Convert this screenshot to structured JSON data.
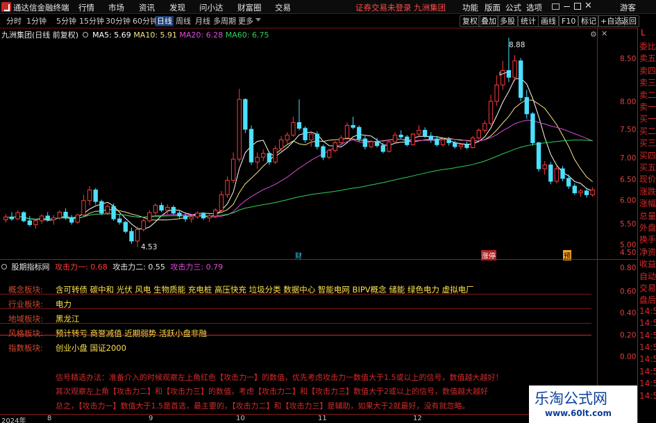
{
  "app_title": "通达信金融终端",
  "menu": [
    "行情",
    "市场",
    "资讯",
    "发现",
    "问小达",
    "财富圈",
    "交易"
  ],
  "warning": "证券交易未登录 九洲集团",
  "sys_menu": [
    "功能",
    "版面",
    "公式",
    "选项"
  ],
  "user": "游客",
  "periods": [
    "分时",
    "1分钟",
    "5分钟",
    "15分钟",
    "30分钟",
    "60分钟",
    "日线",
    "周线",
    "月线",
    "多周期",
    "更多"
  ],
  "active_period": "日线",
  "tools": [
    "复权",
    "叠加",
    "多股",
    "统计",
    "画线",
    "F10",
    "标记",
    "+自选",
    "返回"
  ],
  "chart_header": {
    "title": "九洲集团(日线 前复权)",
    "ma5": "MA5: 5.69",
    "ma10": "MA10: 5.91",
    "ma20": "MA20: 6.28",
    "ma60": "MA60: 6.75"
  },
  "colors": {
    "up": "#ff3b3b",
    "down": "#4ce0ff",
    "ma5": "#ffffff",
    "ma10": "#f4e38a",
    "ma20": "#e04bdc",
    "ma60": "#2fd05a",
    "red_text": "#e33b3b",
    "yellow": "#ffe24a"
  },
  "price_axis": [
    "8.50",
    "8.00",
    "7.50",
    "7.00",
    "6.50",
    "6.00",
    "5.50",
    "5.00",
    "4.50"
  ],
  "rail_items": [
    "委比",
    "卖五",
    "卖四",
    "卖三",
    "卖二",
    "卖一",
    "买一",
    "买二",
    "买三",
    "买四",
    "买五",
    "现价",
    "涨跌",
    "涨幅",
    "总量",
    "外盘",
    "换手",
    "净资",
    "收益",
    "自动",
    "交易",
    "盘后",
    "14:5",
    "14:5",
    "14:5",
    "14:5",
    "14:5",
    "14:5",
    "14:5",
    "14:5"
  ],
  "annotations": {
    "high": "8.88",
    "low": "4.53",
    "tag1": "财",
    "tag2": "涨停",
    "tag3": "预"
  },
  "indicator": {
    "name": "股期指标网",
    "a1": "攻击力一: 0.68",
    "a2": "攻击力二: 0.55",
    "a3": "攻击力三: 0.79",
    "axis": [
      "0.80",
      "0.60",
      "0.40",
      "0.20",
      "0.00"
    ]
  },
  "table": [
    {
      "k": "概念板块:",
      "v": "含可转债 碳中和 光伏 风电 生物质能 充电桩 高压快充 垃圾分类 数据中心 智能电网 BIPV概念 储能 绿色电力 虚拟电厂"
    },
    {
      "k": "行业板块:",
      "v": "电力"
    },
    {
      "k": "地域板块:",
      "v": "黑龙江"
    },
    {
      "k": "风格板块:",
      "v": "预计转亏 商誉减值 近期弱势 活跃小盘非融"
    },
    {
      "k": "指数板块:",
      "v": "创业小盘 国证2000"
    }
  ],
  "notes": [
    "信号精选办法：准备介入的时候观察左上角红色【攻击力一】的数值，优先考虑攻击力一数值大于1.5或以上的信号，数值越大越好！",
    "其次观察左上角【攻击力二】和【攻击力三】的数值，考虑【攻击力二】和【攻击力三】数值大于2或以上的信号，数值越大越好",
    "总之，【攻击力一】数值大于1.5是首选，最主要的，【攻击力二】和【攻击力三】是辅助，如果大于2就最好，没有就忽略。"
  ],
  "date_axis": [
    "2024年",
    "8",
    "9",
    "10",
    "11",
    "12"
  ],
  "watermark": {
    "title": "乐淘公式网",
    "url": "www.60lt.com"
  },
  "chart_data": {
    "type": "candlestick",
    "ylim": [
      4.3,
      9.0
    ],
    "ma": {
      "ma5": "5.69",
      "ma10": "5.91",
      "ma20": "6.28",
      "ma60": "6.75"
    },
    "candles_ohlc": [
      [
        5.1,
        5.22,
        5.04,
        5.16
      ],
      [
        5.16,
        5.26,
        5.08,
        5.12
      ],
      [
        5.12,
        5.3,
        5.1,
        5.25
      ],
      [
        5.25,
        5.28,
        5.05,
        5.08
      ],
      [
        5.08,
        5.18,
        4.96,
        5.0
      ],
      [
        5.0,
        5.12,
        4.92,
        5.08
      ],
      [
        5.08,
        5.22,
        5.02,
        5.18
      ],
      [
        5.18,
        5.26,
        5.06,
        5.1
      ],
      [
        5.1,
        5.2,
        5.0,
        5.14
      ],
      [
        5.14,
        5.3,
        5.1,
        5.26
      ],
      [
        5.26,
        5.34,
        5.1,
        5.15
      ],
      [
        5.15,
        5.2,
        5.0,
        5.05
      ],
      [
        5.05,
        5.22,
        5.02,
        5.2
      ],
      [
        5.2,
        5.62,
        5.16,
        5.5
      ],
      [
        5.5,
        5.8,
        5.4,
        5.72
      ],
      [
        5.72,
        5.76,
        5.42,
        5.48
      ],
      [
        5.48,
        5.52,
        5.2,
        5.24
      ],
      [
        5.24,
        5.42,
        5.2,
        5.38
      ],
      [
        5.38,
        5.44,
        5.08,
        5.12
      ],
      [
        5.12,
        5.22,
        5.0,
        5.05
      ],
      [
        5.05,
        5.08,
        4.82,
        4.86
      ],
      [
        4.86,
        4.94,
        4.6,
        4.66
      ],
      [
        4.66,
        4.96,
        4.53,
        4.9
      ],
      [
        4.9,
        5.12,
        4.86,
        5.08
      ],
      [
        5.08,
        5.3,
        5.04,
        5.25
      ],
      [
        5.25,
        5.44,
        5.2,
        5.4
      ],
      [
        5.4,
        5.46,
        5.26,
        5.3
      ],
      [
        5.3,
        5.42,
        5.22,
        5.36
      ],
      [
        5.36,
        5.4,
        5.2,
        5.24
      ],
      [
        5.24,
        5.3,
        5.12,
        5.18
      ],
      [
        5.18,
        5.24,
        5.06,
        5.12
      ],
      [
        5.12,
        5.2,
        5.04,
        5.16
      ],
      [
        5.16,
        5.28,
        5.12,
        5.24
      ],
      [
        5.24,
        5.26,
        5.1,
        5.14
      ],
      [
        5.14,
        5.22,
        5.06,
        5.18
      ],
      [
        5.18,
        5.34,
        5.14,
        5.3
      ],
      [
        5.3,
        5.7,
        5.26,
        5.62
      ],
      [
        5.62,
        6.0,
        5.56,
        5.92
      ],
      [
        5.92,
        6.5,
        5.86,
        6.36
      ],
      [
        6.36,
        7.82,
        6.3,
        7.6
      ],
      [
        7.6,
        7.62,
        6.9,
        6.98
      ],
      [
        6.98,
        7.06,
        6.24,
        6.3
      ],
      [
        6.3,
        6.5,
        6.16,
        6.4
      ],
      [
        6.4,
        6.56,
        6.32,
        6.48
      ],
      [
        6.48,
        6.52,
        6.24,
        6.3
      ],
      [
        6.3,
        6.64,
        6.26,
        6.58
      ],
      [
        6.58,
        6.84,
        6.52,
        6.76
      ],
      [
        6.76,
        6.92,
        6.68,
        6.86
      ],
      [
        6.86,
        7.24,
        6.82,
        7.12
      ],
      [
        7.12,
        7.6,
        6.96,
        7.0
      ],
      [
        7.0,
        7.04,
        6.7,
        6.76
      ],
      [
        6.76,
        6.92,
        6.62,
        6.88
      ],
      [
        6.88,
        6.94,
        6.56,
        6.62
      ],
      [
        6.62,
        6.66,
        6.34,
        6.4
      ],
      [
        6.4,
        6.58,
        6.36,
        6.54
      ],
      [
        6.54,
        6.74,
        6.5,
        6.7
      ],
      [
        6.7,
        6.86,
        6.64,
        6.8
      ],
      [
        6.8,
        7.12,
        6.76,
        7.06
      ],
      [
        7.06,
        7.24,
        6.98,
        7.02
      ],
      [
        7.02,
        7.06,
        6.72,
        6.78
      ],
      [
        6.78,
        6.84,
        6.56,
        6.62
      ],
      [
        6.62,
        6.76,
        6.58,
        6.72
      ],
      [
        6.72,
        6.8,
        6.6,
        6.64
      ],
      [
        6.64,
        6.7,
        6.48,
        6.52
      ],
      [
        6.52,
        6.76,
        6.5,
        6.72
      ],
      [
        6.72,
        6.92,
        6.68,
        6.86
      ],
      [
        6.86,
        6.96,
        6.78,
        6.82
      ],
      [
        6.82,
        6.86,
        6.62,
        6.66
      ],
      [
        6.66,
        6.9,
        6.64,
        6.88
      ],
      [
        6.88,
        7.06,
        6.82,
        6.96
      ],
      [
        6.96,
        7.02,
        6.8,
        6.84
      ],
      [
        6.84,
        6.92,
        6.7,
        6.78
      ],
      [
        6.78,
        6.84,
        6.62,
        6.66
      ],
      [
        6.66,
        6.8,
        6.62,
        6.76
      ],
      [
        6.76,
        6.82,
        6.64,
        6.7
      ],
      [
        6.7,
        6.74,
        6.58,
        6.62
      ],
      [
        6.62,
        6.7,
        6.56,
        6.66
      ],
      [
        6.66,
        6.72,
        6.56,
        6.6
      ],
      [
        6.6,
        6.84,
        6.58,
        6.8
      ],
      [
        6.8,
        7.0,
        6.76,
        6.96
      ],
      [
        6.96,
        7.16,
        6.9,
        7.1
      ],
      [
        7.1,
        7.7,
        7.06,
        7.56
      ],
      [
        7.56,
        8.1,
        7.46,
        7.9
      ],
      [
        7.9,
        8.4,
        7.8,
        8.2
      ],
      [
        8.2,
        8.88,
        7.96,
        8.06
      ],
      [
        8.06,
        8.52,
        7.98,
        8.4
      ],
      [
        8.4,
        8.46,
        7.56,
        7.64
      ],
      [
        7.64,
        7.8,
        7.2,
        7.3
      ],
      [
        7.3,
        7.34,
        6.64,
        6.7
      ],
      [
        6.7,
        6.72,
        6.1,
        6.16
      ],
      [
        6.16,
        6.32,
        6.04,
        6.24
      ],
      [
        6.24,
        6.3,
        5.84,
        5.9
      ],
      [
        5.9,
        6.22,
        5.86,
        6.16
      ],
      [
        6.16,
        6.22,
        5.9,
        5.96
      ],
      [
        5.96,
        6.04,
        5.74,
        5.8
      ],
      [
        5.8,
        5.86,
        5.62,
        5.66
      ],
      [
        5.66,
        5.74,
        5.58,
        5.7
      ],
      [
        5.7,
        5.74,
        5.56,
        5.62
      ],
      [
        5.62,
        5.78,
        5.58,
        5.72
      ]
    ]
  }
}
